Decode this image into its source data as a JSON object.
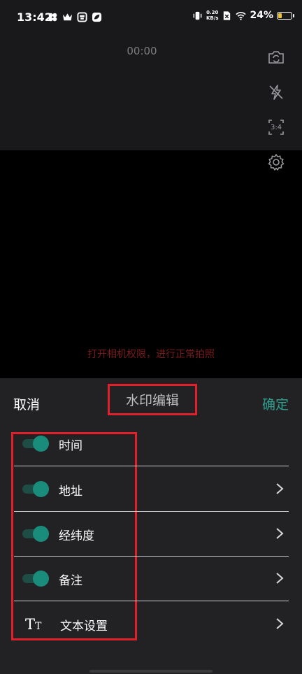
{
  "status_bar": {
    "time": "13:42",
    "net_speed_value": "0.20",
    "net_speed_unit": "KB/s",
    "battery_percent": "24%",
    "left_icons": [
      "grid-app-icon",
      "crown-icon",
      "box-app-icon",
      "leaf-app-icon"
    ],
    "right_icons": [
      "vibrate-icon",
      "network-speed",
      "no-sim-icon",
      "wifi-icon",
      "battery-icon"
    ]
  },
  "camera": {
    "timer": "00:00",
    "tools": [
      "camera-switch-icon",
      "flash-off-icon",
      "aspect-ratio-icon",
      "settings-gear-icon"
    ],
    "ratio_label": "3:4",
    "permission_message": "打开相机权限，进行正常拍照"
  },
  "sheet": {
    "cancel_label": "取消",
    "title": "水印编辑",
    "confirm_label": "确定",
    "accent_color": "#2fa08e",
    "options": [
      {
        "label": "时间",
        "enabled": true,
        "has_chevron": false
      },
      {
        "label": "地址",
        "enabled": true,
        "has_chevron": true
      },
      {
        "label": "经纬度",
        "enabled": true,
        "has_chevron": true
      },
      {
        "label": "备注",
        "enabled": true,
        "has_chevron": true
      }
    ],
    "text_settings": {
      "icon_text": "TT",
      "label": "文本设置"
    }
  }
}
